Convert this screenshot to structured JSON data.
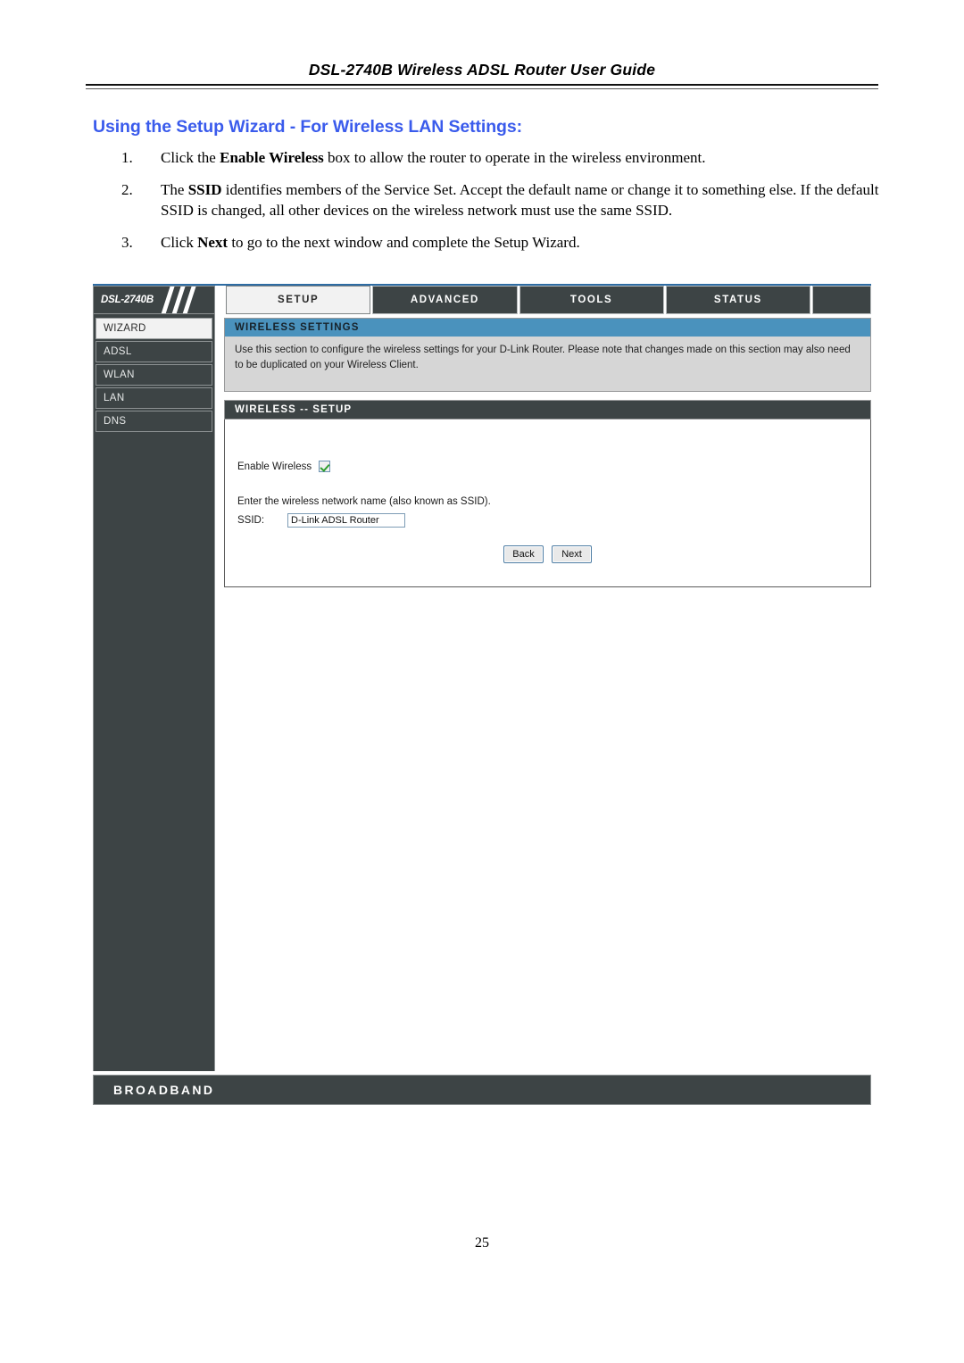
{
  "document": {
    "header_title": "DSL-2740B Wireless ADSL Router User Guide",
    "section_heading": "Using the Setup Wizard - For Wireless LAN Settings:",
    "page_number": "25",
    "heading_color": "#3a5bec",
    "steps": [
      {
        "num": "1.",
        "parts": [
          {
            "text": "Click the ",
            "bold": false
          },
          {
            "text": "Enable Wireless",
            "bold": true
          },
          {
            "text": " box to allow the router to operate in the wireless environment.",
            "bold": false
          }
        ]
      },
      {
        "num": "2.",
        "parts": [
          {
            "text": "The ",
            "bold": false
          },
          {
            "text": "SSID",
            "bold": true
          },
          {
            "text": " identifies members of the Service Set. Accept the default name or change it to something else. If the default SSID is changed, all other devices on the wireless network must use the same SSID.",
            "bold": false
          }
        ]
      },
      {
        "num": "3.",
        "parts": [
          {
            "text": "Click ",
            "bold": false
          },
          {
            "text": "Next",
            "bold": true
          },
          {
            "text": " to go to the next window and complete the Setup Wizard.",
            "bold": false
          }
        ]
      }
    ]
  },
  "router_ui": {
    "brand": "DSL-2740B",
    "nav_tabs": [
      {
        "label": "SETUP",
        "active": true
      },
      {
        "label": "ADVANCED",
        "active": false
      },
      {
        "label": "TOOLS",
        "active": false
      },
      {
        "label": "STATUS",
        "active": false
      }
    ],
    "sidebar": {
      "items": [
        {
          "label": "WIZARD",
          "active": true
        },
        {
          "label": "ADSL",
          "active": false
        },
        {
          "label": "WLAN",
          "active": false
        },
        {
          "label": "LAN",
          "active": false
        },
        {
          "label": "DNS",
          "active": false
        }
      ]
    },
    "info_panel": {
      "title": "WIRELESS SETTINGS",
      "body": "Use this section to configure the wireless settings for your D-Link Router. Please note that changes made on this section may also need to be duplicated on your Wireless Client.",
      "header_color": "#4a92bd"
    },
    "setup_panel": {
      "title": "WIRELESS -- SETUP",
      "enable_wireless_label": "Enable Wireless",
      "enable_wireless_checked": "checked",
      "ssid_description": "Enter the wireless network name (also known as SSID).",
      "ssid_label": "SSID:",
      "ssid_value": "D-Link ADSL Router",
      "ssid_placeholder": "SSID",
      "back_button": "Back",
      "next_button": "Next"
    },
    "footer": {
      "text": "BROADBAND"
    }
  }
}
